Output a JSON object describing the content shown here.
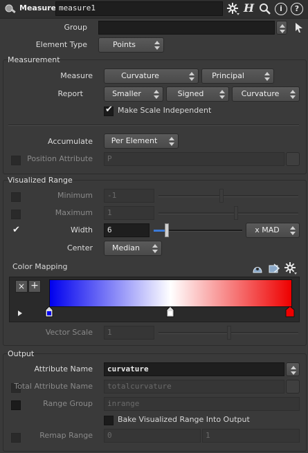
{
  "header": {
    "node_type": "Measure",
    "node_name": "measure1",
    "help_label": "?",
    "info_label": "i",
    "hscript_label": "H"
  },
  "top": {
    "group_label": "Group",
    "group_value": "",
    "element_type_label": "Element Type",
    "element_type_value": "Points"
  },
  "measurement": {
    "title": "Measurement",
    "measure_label": "Measure",
    "measure_value": "Curvature",
    "measure_sub_value": "Principal",
    "report_label": "Report",
    "report_value1": "Smaller",
    "report_value2": "Signed",
    "report_value3": "Curvature",
    "scale_independent_label": "Make Scale Independent",
    "scale_independent_checked": true,
    "accumulate_label": "Accumulate",
    "accumulate_value": "Per Element",
    "position_attr_label": "Position Attribute",
    "position_attr_value": "P"
  },
  "visualized": {
    "title": "Visualized Range",
    "minimum_label": "Minimum",
    "minimum_value": "-1",
    "maximum_label": "Maximum",
    "maximum_value": "1",
    "width_label": "Width",
    "width_value": "6",
    "width_mode": "x MAD",
    "center_label": "Center",
    "center_value": "Median",
    "color_mapping_label": "Color Mapping",
    "ramp_colors": [
      "#0000ee",
      "#ffffff",
      "#ee0000"
    ],
    "vector_scale_label": "Vector Scale",
    "vector_scale_value": "1"
  },
  "output": {
    "title": "Output",
    "attribute_name_label": "Attribute Name",
    "attribute_name_value": "curvature",
    "total_attr_label": "Total Attribute Name",
    "total_attr_value": "totalcurvature",
    "range_group_label": "Range Group",
    "range_group_value": "inrange",
    "bake_label": "Bake Visualized Range Into Output",
    "remap_label": "Remap Range",
    "remap_min": "0",
    "remap_max": "1"
  }
}
